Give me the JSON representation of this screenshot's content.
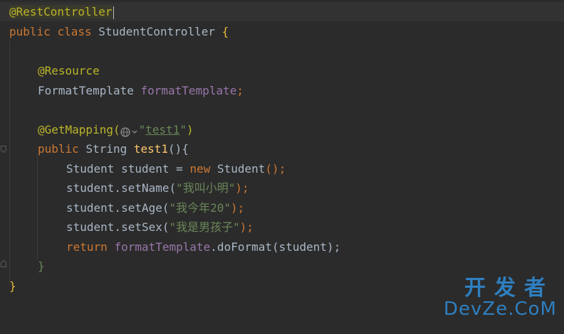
{
  "editor": {
    "lines": [
      {
        "id": "l1",
        "tokens": {
          "ann": "@RestController"
        }
      },
      {
        "id": "l2",
        "tokens": {
          "kw1": "public",
          "kw2": "class",
          "name": "StudentController",
          "brace": "{"
        }
      },
      {
        "id": "l4",
        "tokens": {
          "ann": "@Resource"
        }
      },
      {
        "id": "l5",
        "tokens": {
          "type": "FormatTemplate",
          "field": "formatTemplate",
          "semi": ";"
        }
      },
      {
        "id": "l7",
        "tokens": {
          "ann": "@GetMapping(",
          "str": "\"",
          "url": "test1",
          "str2": "\"",
          "close": ")"
        }
      },
      {
        "id": "l8",
        "tokens": {
          "kw1": "public",
          "type": "String",
          "fn": "test1",
          "parens": "()",
          "brace": "{"
        }
      },
      {
        "id": "l9",
        "tokens": {
          "type": "Student",
          "var": "student",
          "eq": "=",
          "kw": "new",
          "ctor": "Student",
          "end": "();"
        }
      },
      {
        "id": "l10",
        "tokens": {
          "obj": "student.setName(",
          "str": "\"我叫小明\"",
          "end": ");"
        }
      },
      {
        "id": "l11",
        "tokens": {
          "obj": "student.setAge(",
          "str": "\"我今年20\"",
          "end": ");"
        }
      },
      {
        "id": "l12",
        "tokens": {
          "obj": "student.setSex(",
          "str": "\"我是男孩子\"",
          "end": ");"
        }
      },
      {
        "id": "l13",
        "tokens": {
          "kw": "return",
          "field": "formatTemplate",
          "call": ".doFormat(student);"
        }
      },
      {
        "id": "l14",
        "tokens": {
          "brace": "}"
        }
      },
      {
        "id": "l15",
        "tokens": {
          "brace": "}"
        }
      }
    ]
  },
  "watermark": {
    "top": "开发者",
    "bottom": "DevZe.CoM"
  },
  "icons": {
    "gutter_fold": "fold-marker-icon",
    "globe": "globe-icon"
  }
}
